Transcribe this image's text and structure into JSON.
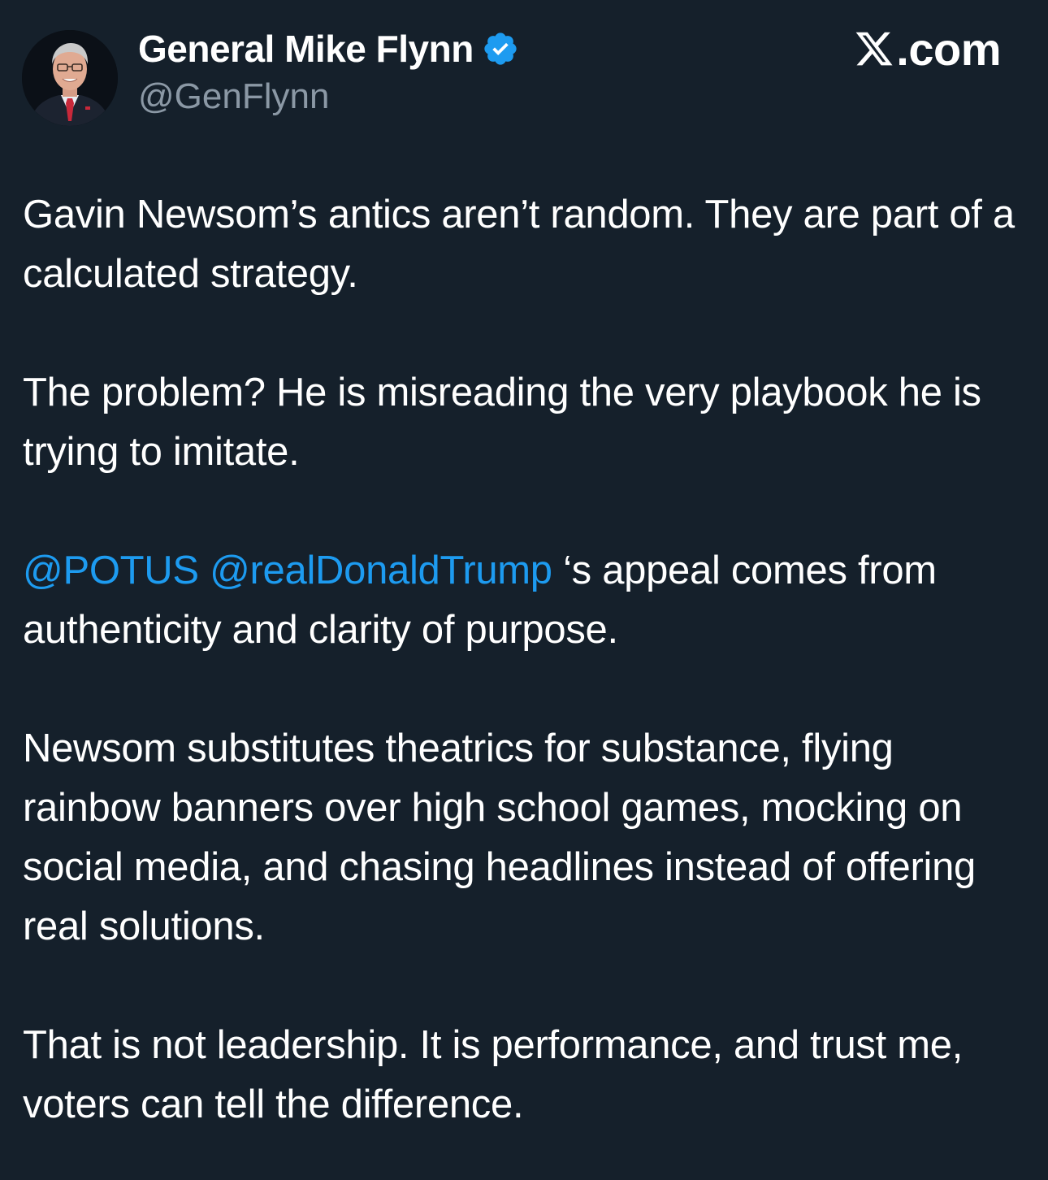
{
  "author": {
    "display_name": "General Mike Flynn",
    "handle": "@GenFlynn",
    "verified_icon": "verified-badge-icon"
  },
  "brand": {
    "text": ".com",
    "icon": "x-logo-icon"
  },
  "tweet": {
    "p1": "Gavin Newsom’s antics aren’t random. They are part of a calculated strategy.",
    "p2": "The problem? He is misreading the very playbook he is trying to imitate.",
    "p3_mention1": "@POTUS",
    "p3_mention2": "@realDonaldTrump",
    "p3_rest": "‘s appeal comes from authenticity and clarity of purpose.",
    "p4": "Newsom substitutes theatrics for substance, flying rainbow banners over high school games, mocking on social media, and chasing headlines instead of offering real solutions.",
    "p5": "That is not leadership. It is performance, and trust me, voters can tell the difference."
  },
  "colors": {
    "background": "#15202b",
    "text": "#ffffff",
    "secondary_text": "#8b98a5",
    "link": "#1d9bf0",
    "verified": "#1d9bf0"
  }
}
